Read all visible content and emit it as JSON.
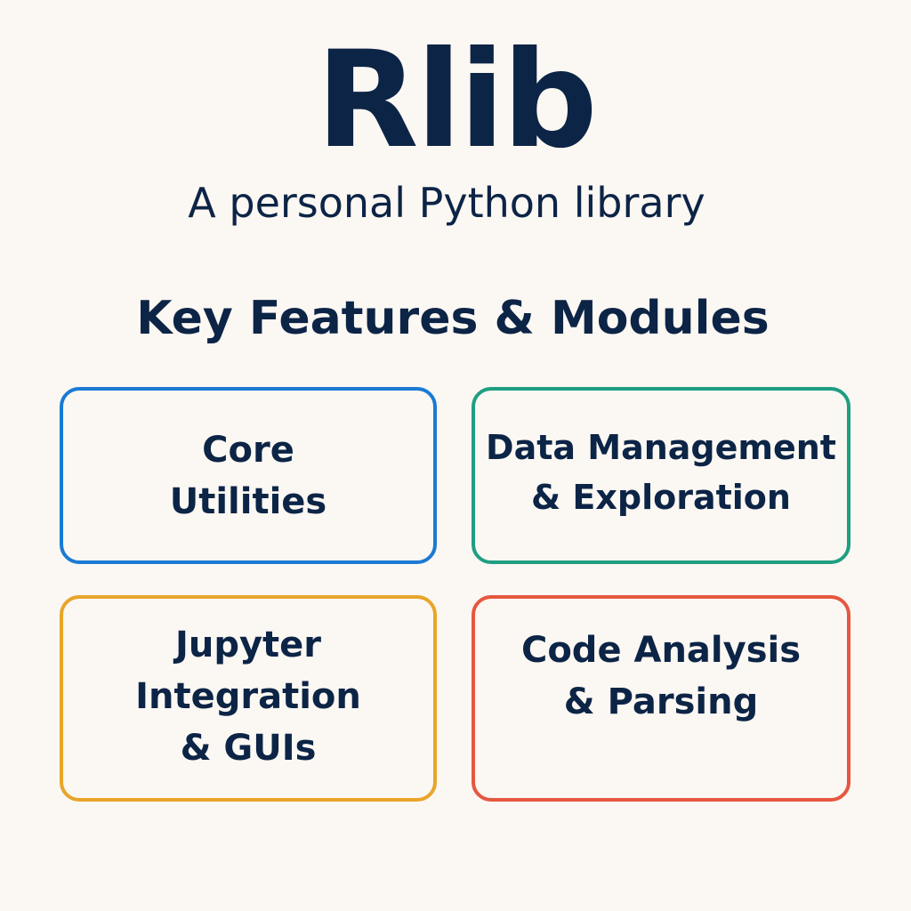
{
  "title": "Rlib",
  "subtitle": "A personal Python library",
  "section_heading": "Key Features & Modules",
  "features": [
    {
      "label": "Core\nUtilities",
      "border_color": "#1a7ad4"
    },
    {
      "label": "Data Management\n& Exploration",
      "border_color": "#1f9e82"
    },
    {
      "label": "Jupyter\nIntegration\n& GUIs",
      "border_color": "#e8a52a"
    },
    {
      "label": "Code Analysis\n& Parsing",
      "border_color": "#e6573f"
    }
  ]
}
